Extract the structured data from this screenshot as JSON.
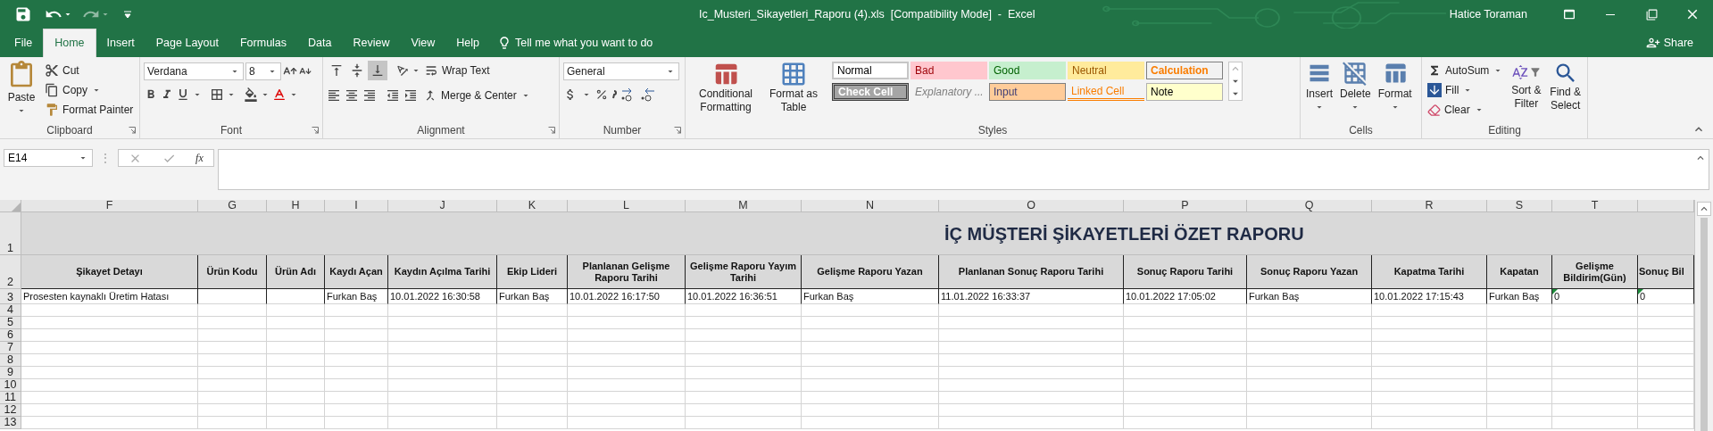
{
  "title_bar": {
    "title": "Ic_Musteri_Sikayetleri_Raporu (4).xls  [Compatibility Mode]  -  Excel",
    "user": "Hatice Toraman"
  },
  "tabs": [
    {
      "label": "File",
      "selected": false
    },
    {
      "label": "Home",
      "selected": true
    },
    {
      "label": "Insert",
      "selected": false
    },
    {
      "label": "Page Layout",
      "selected": false
    },
    {
      "label": "Formulas",
      "selected": false
    },
    {
      "label": "Data",
      "selected": false
    },
    {
      "label": "Review",
      "selected": false
    },
    {
      "label": "View",
      "selected": false
    },
    {
      "label": "Help",
      "selected": false
    }
  ],
  "tell_me": "Tell me what you want to do",
  "share": "Share",
  "ribbon": {
    "clipboard": {
      "label": "Clipboard",
      "paste": "Paste",
      "cut": "Cut",
      "copy": "Copy",
      "format_painter": "Format Painter"
    },
    "font": {
      "label": "Font",
      "font_name": "Verdana",
      "font_size": "8"
    },
    "alignment": {
      "label": "Alignment",
      "vertical_align": [
        {
          "selected": false
        },
        {
          "selected": false
        },
        {
          "selected": true
        }
      ],
      "wrap_text": "Wrap Text",
      "merge_center": "Merge & Center"
    },
    "number": {
      "label": "Number",
      "format": "General"
    },
    "styles": {
      "label": "Styles",
      "conditional_formatting": "Conditional Formatting",
      "format_as_table": "Format as Table",
      "cell_styles": [
        {
          "label": "Normal",
          "kind": "normal"
        },
        {
          "label": "Bad",
          "kind": "bad"
        },
        {
          "label": "Good",
          "kind": "good"
        },
        {
          "label": "Neutral",
          "kind": "neutral"
        },
        {
          "label": "Calculation",
          "kind": "calculation"
        },
        {
          "label": "Check Cell",
          "kind": "check"
        },
        {
          "label": "Explanatory ...",
          "kind": "explanatory"
        },
        {
          "label": "Input",
          "kind": "input"
        },
        {
          "label": "Linked Cell",
          "kind": "linked"
        },
        {
          "label": "Note",
          "kind": "note"
        }
      ]
    },
    "cells": {
      "label": "Cells",
      "buttons": [
        "Insert",
        "Delete",
        "Format"
      ]
    },
    "editing": {
      "label": "Editing",
      "autosum": "AutoSum",
      "fill": "Fill",
      "clear": "Clear",
      "sort_filter": "Sort & Filter",
      "find_select": "Find & Select"
    }
  },
  "formula_bar": {
    "name_box": "E14",
    "separator": "⋮",
    "fx": "fx"
  },
  "sheet": {
    "columns": [
      "F",
      "G",
      "H",
      "I",
      "J",
      "K",
      "L",
      "M",
      "N",
      "O",
      "P",
      "Q",
      "R",
      "S",
      "T"
    ],
    "title_row": {
      "row": "1",
      "title": "İÇ MÜŞTERİ ŞİKAYETLERİ ÖZET RAPORU"
    },
    "header_row": {
      "row": "2",
      "cells": [
        "Şikayet Detayı",
        "Ürün Kodu",
        "Ürün Adı",
        "Kaydı Açan",
        "Kaydın Açılma Tarihi",
        "Ekip Lideri",
        "Planlanan Gelişme Raporu Tarihi",
        "Gelişme Raporu Yayım Tarihi",
        "Gelişme Raporu Yazan",
        "Planlanan Sonuç Raporu Tarihi",
        "Sonuç Raporu Tarihi",
        "Sonuç Raporu Yazan",
        "Kapatma Tarihi",
        "Kapatan",
        "Gelişme Bildirim(Gün)",
        "Sonuç Bil"
      ]
    },
    "data_rows": [
      {
        "row": "3",
        "cells": [
          {
            "text": "Prosesten kaynaklı Üretim Hatası",
            "flagged": false
          },
          {
            "flagged": false
          },
          {
            "flagged": false
          },
          {
            "text": "Furkan Baş",
            "flagged": false
          },
          {
            "text": "10.01.2022 16:30:58",
            "flagged": false
          },
          {
            "text": "Furkan Baş",
            "flagged": false
          },
          {
            "text": "10.01.2022 16:17:50",
            "flagged": false
          },
          {
            "text": "10.01.2022 16:36:51",
            "flagged": false
          },
          {
            "text": "Furkan Baş",
            "flagged": false
          },
          {
            "text": "11.01.2022 16:33:37",
            "flagged": false
          },
          {
            "text": "10.01.2022 17:05:02",
            "flagged": false
          },
          {
            "text": "Furkan Baş",
            "flagged": false
          },
          {
            "text": "10.01.2022 17:15:43",
            "flagged": false
          },
          {
            "text": "Furkan Baş",
            "flagged": false
          },
          {
            "text": "0",
            "flagged": true
          },
          {
            "text": "0",
            "flagged": true
          }
        ]
      }
    ],
    "empty_rows": [
      "4",
      "5",
      "6",
      "7",
      "8",
      "9",
      "10",
      "11",
      "12",
      "13"
    ]
  }
}
